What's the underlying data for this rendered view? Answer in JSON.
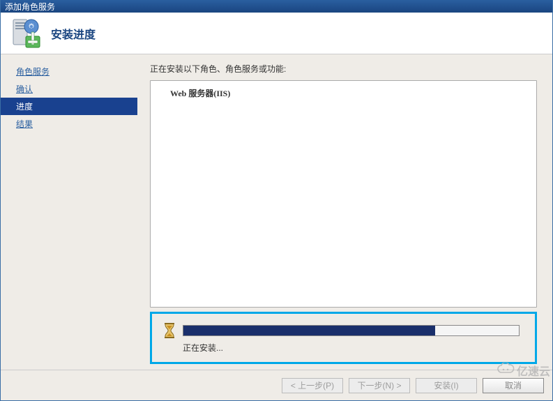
{
  "window": {
    "title": "添加角色服务"
  },
  "header": {
    "title": "安装进度"
  },
  "sidebar": {
    "items": [
      {
        "label": "角色服务",
        "active": false
      },
      {
        "label": "确认",
        "active": false
      },
      {
        "label": "进度",
        "active": true
      },
      {
        "label": "结果",
        "active": false
      }
    ]
  },
  "main": {
    "message": "正在安装以下角色、角色服务或功能:",
    "content_item": "Web 服务器(IIS)"
  },
  "progress": {
    "percent": 75,
    "status": "正在安装..."
  },
  "footer": {
    "prev": "< 上一步(P)",
    "next": "下一步(N) >",
    "install": "安装(I)",
    "cancel": "取消"
  },
  "watermark": {
    "text": "亿速云"
  }
}
